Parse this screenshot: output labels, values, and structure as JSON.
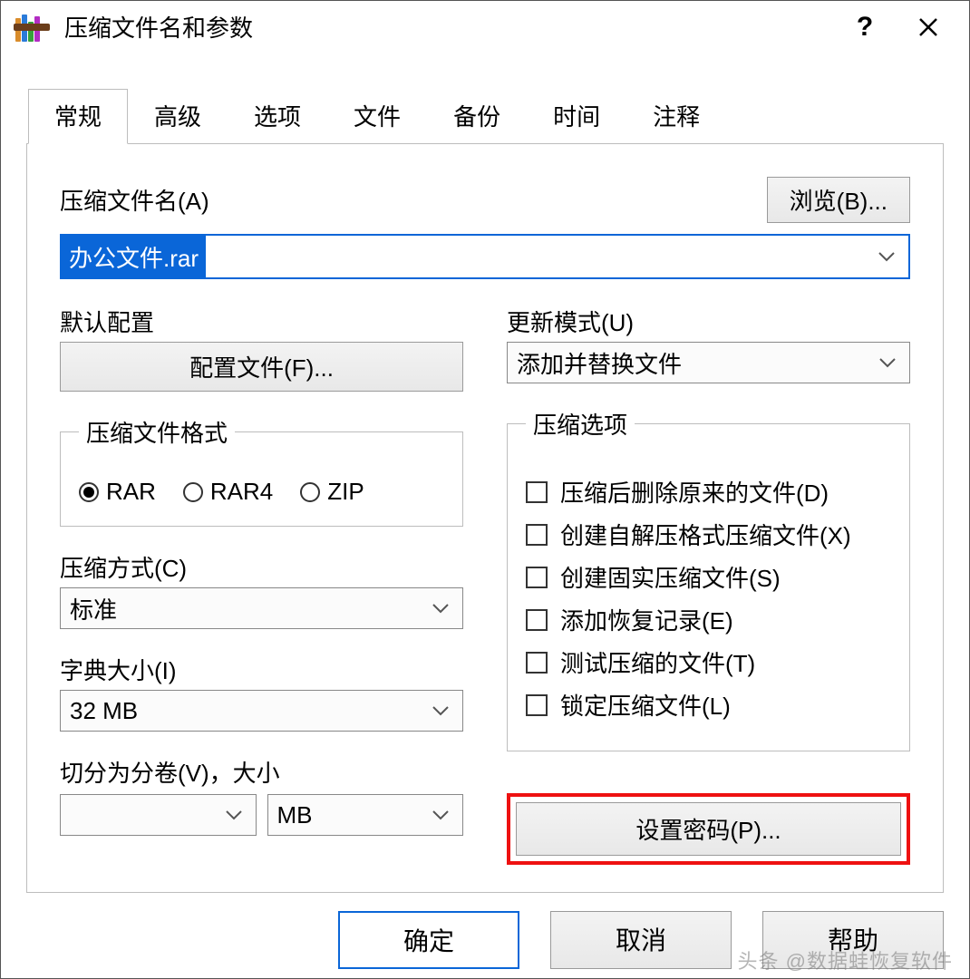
{
  "window": {
    "title": "压缩文件名和参数"
  },
  "tabs": {
    "general": "常规",
    "advanced": "高级",
    "options": "选项",
    "files": "文件",
    "backup": "备份",
    "time": "时间",
    "comment": "注释"
  },
  "filename": {
    "label": "压缩文件名(A)",
    "value": "办公文件.rar",
    "browse": "浏览(B)..."
  },
  "defaultProfile": {
    "label": "默认配置",
    "button": "配置文件(F)..."
  },
  "updateMode": {
    "label": "更新模式(U)",
    "value": "添加并替换文件"
  },
  "formatGroup": {
    "legend": "压缩文件格式",
    "rar": "RAR",
    "rar4": "RAR4",
    "zip": "ZIP",
    "selected": "rar"
  },
  "method": {
    "label": "压缩方式(C)",
    "value": "标准"
  },
  "dict": {
    "label": "字典大小(I)",
    "value": "32 MB"
  },
  "split": {
    "label": "切分为分卷(V)，大小",
    "value": "",
    "unit": "MB"
  },
  "optionsGroup": {
    "legend": "压缩选项",
    "delete": "压缩后删除原来的文件(D)",
    "sfx": "创建自解压格式压缩文件(X)",
    "solid": "创建固实压缩文件(S)",
    "recovery": "添加恢复记录(E)",
    "test": "测试压缩的文件(T)",
    "lock": "锁定压缩文件(L)"
  },
  "password": {
    "button": "设置密码(P)..."
  },
  "footer": {
    "ok": "确定",
    "cancel": "取消",
    "help": "帮助"
  },
  "watermark": "头条 @数据蛙恢复软件"
}
